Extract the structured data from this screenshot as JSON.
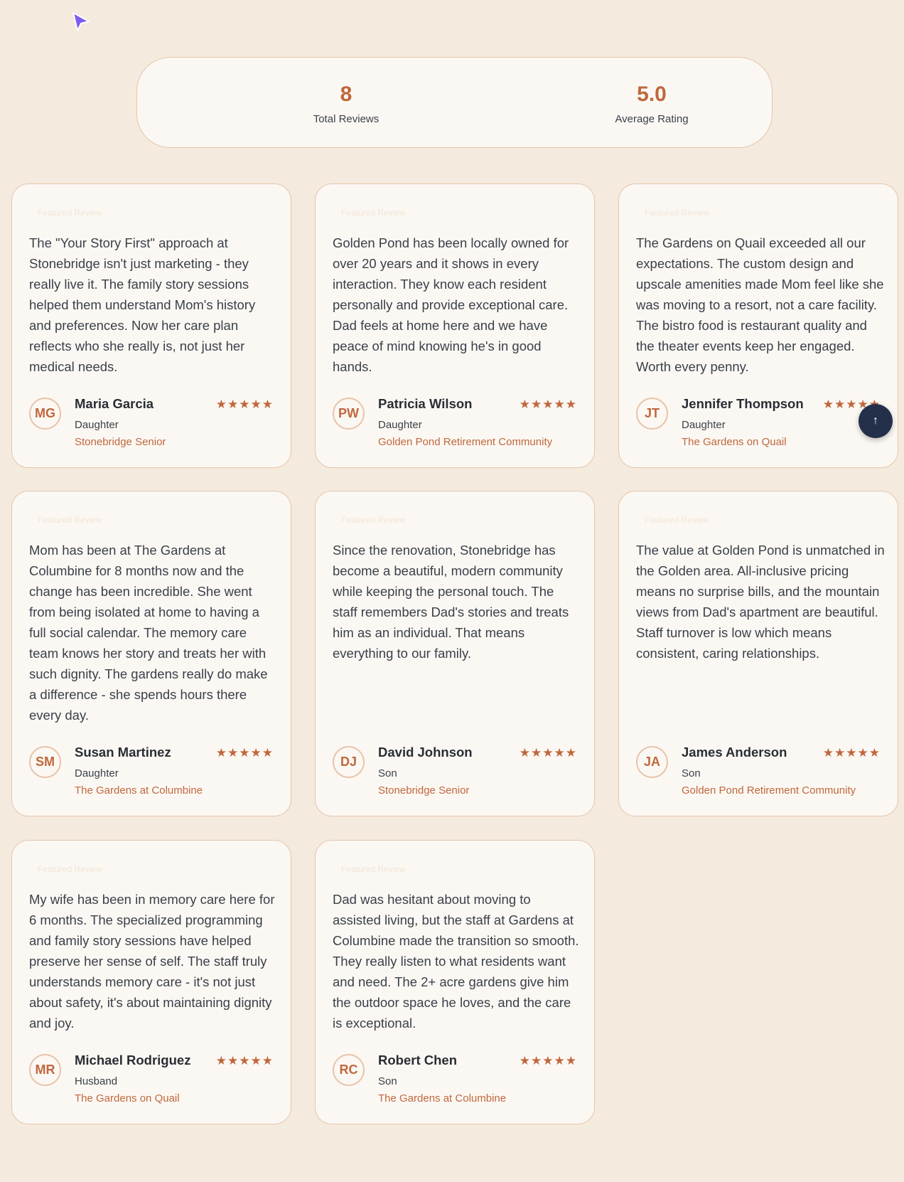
{
  "stats": {
    "total_reviews_value": "8",
    "total_reviews_label": "Total Reviews",
    "average_rating_value": "5.0",
    "average_rating_label": "Average Rating"
  },
  "colors": {
    "accent": "#c0673d",
    "background": "#f4eadd",
    "card": "#fbf8f3",
    "scroll_button": "#24304a"
  },
  "reviews": [
    {
      "badge": "Featured Review",
      "quote": "The \"Your Story First\" approach at Stonebridge isn't just marketing - they really live it. The family story sessions helped them understand Mom's history and preferences. Now her care plan reflects who she really is, not just her medical needs.",
      "initials": "MG",
      "name": "Maria Garcia",
      "relation": "Daughter",
      "community": "Stonebridge Senior",
      "rating": 5,
      "stars": "★★★★★"
    },
    {
      "badge": "Featured Review",
      "quote": "Golden Pond has been locally owned for over 20 years and it shows in every interaction. They know each resident personally and provide exceptional care. Dad feels at home here and we have peace of mind knowing he's in good hands.",
      "initials": "PW",
      "name": "Patricia Wilson",
      "relation": "Daughter",
      "community": "Golden Pond Retirement Community",
      "rating": 5,
      "stars": "★★★★★"
    },
    {
      "badge": "Featured Review",
      "quote": "The Gardens on Quail exceeded all our expectations. The custom design and upscale amenities made Mom feel like she was moving to a resort, not a care facility. The bistro food is restaurant quality and the theater events keep her engaged. Worth every penny.",
      "initials": "JT",
      "name": "Jennifer Thompson",
      "relation": "Daughter",
      "community": "The Gardens on Quail",
      "rating": 5,
      "stars": "★★★★★"
    },
    {
      "badge": "Featured Review",
      "quote": "Mom has been at The Gardens at Columbine for 8 months now and the change has been incredible. She went from being isolated at home to having a full social calendar. The memory care team knows her story and treats her with such dignity. The gardens really do make a difference - she spends hours there every day.",
      "initials": "SM",
      "name": "Susan Martinez",
      "relation": "Daughter",
      "community": "The Gardens at Columbine",
      "rating": 5,
      "stars": "★★★★★"
    },
    {
      "badge": "Featured Review",
      "quote": "Since the renovation, Stonebridge has become a beautiful, modern community while keeping the personal touch. The staff remembers Dad's stories and treats him as an individual. That means everything to our family.",
      "initials": "DJ",
      "name": "David Johnson",
      "relation": "Son",
      "community": "Stonebridge Senior",
      "rating": 5,
      "stars": "★★★★★"
    },
    {
      "badge": "Featured Review",
      "quote": "The value at Golden Pond is unmatched in the Golden area. All-inclusive pricing means no surprise bills, and the mountain views from Dad's apartment are beautiful. Staff turnover is low which means consistent, caring relationships.",
      "initials": "JA",
      "name": "James Anderson",
      "relation": "Son",
      "community": "Golden Pond Retirement Community",
      "rating": 5,
      "stars": "★★★★★"
    },
    {
      "badge": "Featured Review",
      "quote": "My wife has been in memory care here for 6 months. The specialized programming and family story sessions have helped preserve her sense of self. The staff truly understands memory care - it's not just about safety, it's about maintaining dignity and joy.",
      "initials": "MR",
      "name": "Michael Rodriguez",
      "relation": "Husband",
      "community": "The Gardens on Quail",
      "rating": 5,
      "stars": "★★★★★"
    },
    {
      "badge": "Featured Review",
      "quote": "Dad was hesitant about moving to assisted living, but the staff at Gardens at Columbine made the transition so smooth. They really listen to what residents want and need. The 2+ acre gardens give him the outdoor space he loves, and the care is exceptional.",
      "initials": "RC",
      "name": "Robert Chen",
      "relation": "Son",
      "community": "The Gardens at Columbine",
      "rating": 5,
      "stars": "★★★★★"
    }
  ],
  "scroll_top": {
    "icon": "arrow-up-icon",
    "glyph": "↑"
  }
}
